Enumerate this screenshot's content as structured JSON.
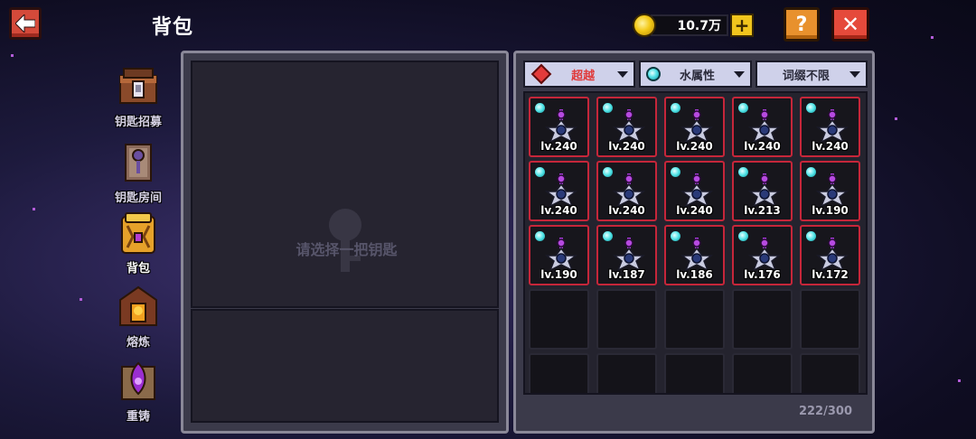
{
  "header": {
    "title": "背包",
    "coins": "10.7万",
    "help_label": "?",
    "close_label": "✕",
    "add_label": "+"
  },
  "sidebar": {
    "items": [
      {
        "label": "钥匙招募",
        "icon": "recruit-chest-icon",
        "active": false
      },
      {
        "label": "钥匙房间",
        "icon": "key-room-icon",
        "active": false
      },
      {
        "label": "背包",
        "icon": "backpack-icon",
        "active": true
      },
      {
        "label": "熔炼",
        "icon": "smelt-furnace-icon",
        "active": false
      },
      {
        "label": "重铸",
        "icon": "reforge-icon",
        "active": false
      }
    ]
  },
  "detail_panel": {
    "placeholder": "请选择一把钥匙"
  },
  "filters": {
    "rarity": "超越",
    "element": "水属性",
    "affix": "词缀不限"
  },
  "inventory": {
    "items": [
      {
        "level": "lv.240"
      },
      {
        "level": "lv.240"
      },
      {
        "level": "lv.240"
      },
      {
        "level": "lv.240"
      },
      {
        "level": "lv.240"
      },
      {
        "level": "lv.240"
      },
      {
        "level": "lv.240"
      },
      {
        "level": "lv.240"
      },
      {
        "level": "lv.213"
      },
      {
        "level": "lv.190"
      },
      {
        "level": "lv.190"
      },
      {
        "level": "lv.187"
      },
      {
        "level": "lv.186"
      },
      {
        "level": "lv.176"
      },
      {
        "level": "lv.172"
      }
    ],
    "empty_slots_visible": 10,
    "count": "222/300"
  },
  "colors": {
    "accent_red": "#e54a3b",
    "slot_border_red": "#c6263a",
    "gold": "#f1c51d",
    "panel": "#3b3a4a"
  }
}
